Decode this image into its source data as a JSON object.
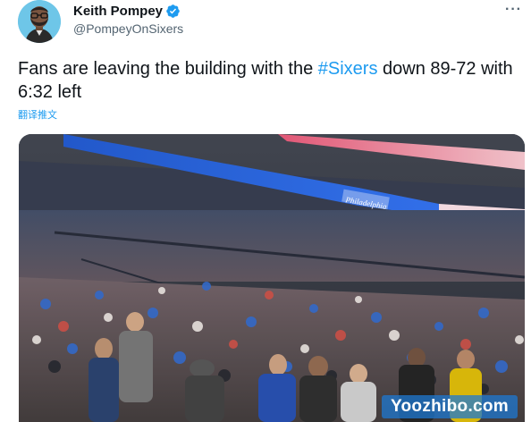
{
  "author": {
    "display_name": "Keith Pompey",
    "handle": "@PompeyOnSixers"
  },
  "tweet": {
    "text_before": "Fans are leaving the building with the ",
    "hashtag": "#Sixers",
    "text_after": " down 89-72 with  6:32 left",
    "translate_label": "翻译推文"
  },
  "media": {
    "description_icon": "arena-crowd-photo",
    "arena_sign": "Philadelphia",
    "watermark": "Yoozhibo.com"
  },
  "colors": {
    "accent": "#1d9bf0",
    "text": "#0f1419",
    "secondary": "#536471"
  },
  "icons": {
    "verified": "verified-badge-icon",
    "more": "more-options-icon"
  }
}
